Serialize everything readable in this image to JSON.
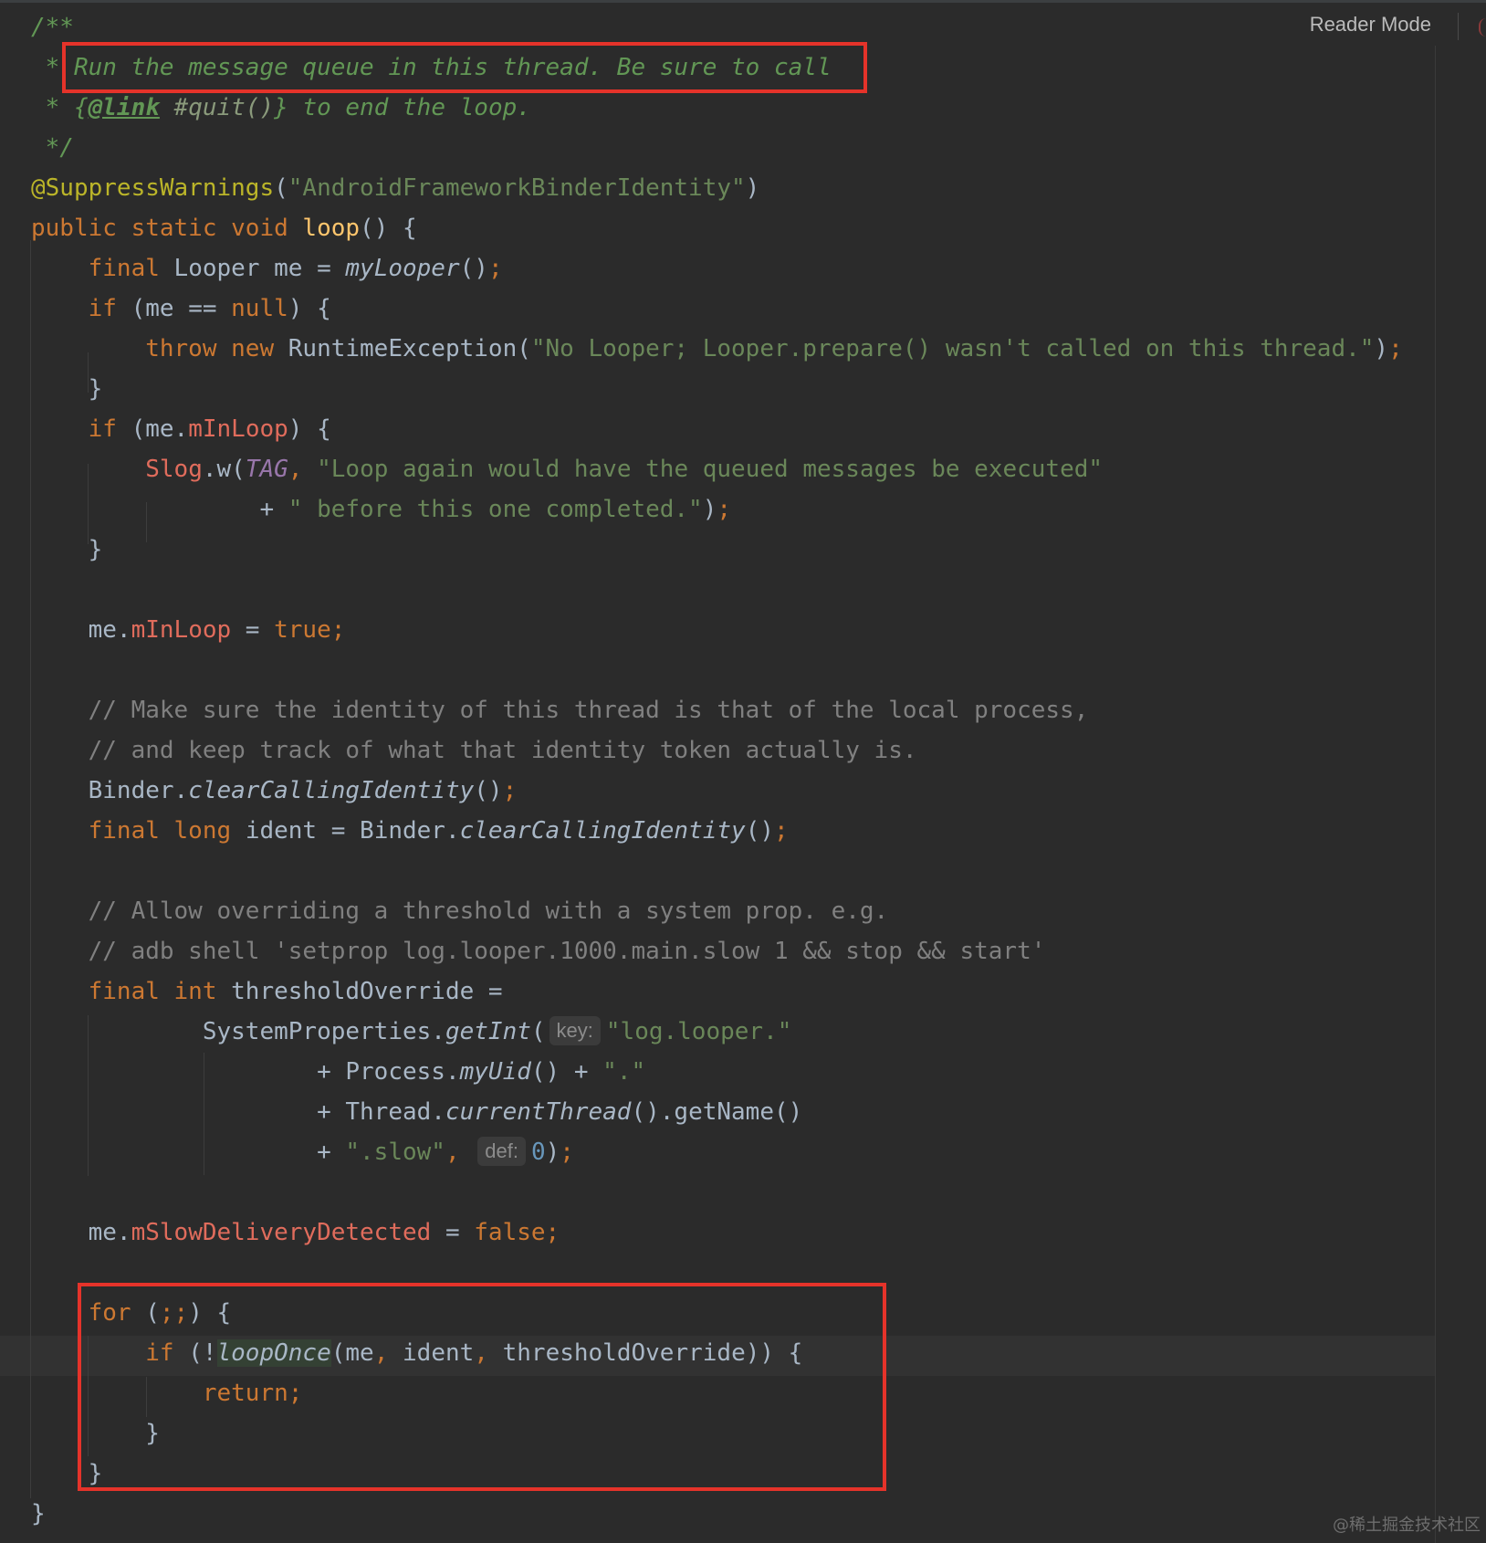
{
  "toolbar": {
    "reader_mode": "Reader Mode"
  },
  "theme": {
    "background": "#2b2b2b",
    "keyword": "#cc7832",
    "string": "#6a8759",
    "doc_comment": "#629755",
    "line_comment": "#808080",
    "field": "#e06c5c",
    "annotation": "#bbb529",
    "method_decl": "#ffc66d",
    "highlight_box": "#e5332a"
  },
  "code_lines": [
    [
      {
        "t": "/**",
        "c": "doc",
        "i": true
      }
    ],
    [
      {
        "t": " * ",
        "c": "doc",
        "i": true
      },
      {
        "t": "Run the message queue in this thread. Be sure to call",
        "c": "doc",
        "i": true
      }
    ],
    [
      {
        "t": " * {",
        "c": "doc",
        "i": true
      },
      {
        "t": "@link",
        "c": "doclink",
        "i": true
      },
      {
        "t": " #quit()",
        "c": "docref",
        "i": true
      },
      {
        "t": "} to end the loop.",
        "c": "doc",
        "i": true
      }
    ],
    [
      {
        "t": " */",
        "c": "doc",
        "i": true
      }
    ],
    [
      {
        "t": "@SuppressWarnings",
        "c": "ann"
      },
      {
        "t": "(",
        "c": "txt"
      },
      {
        "t": "\"AndroidFrameworkBinderIdentity\"",
        "c": "str"
      },
      {
        "t": ")",
        "c": "txt"
      }
    ],
    [
      {
        "t": "public static void ",
        "c": "kw"
      },
      {
        "t": "loop",
        "c": "mdecl"
      },
      {
        "t": "() {",
        "c": "txt"
      }
    ],
    [
      {
        "t": "    final ",
        "c": "kw"
      },
      {
        "t": "Looper me = ",
        "c": "txt"
      },
      {
        "t": "myLooper",
        "c": "txt",
        "i": true
      },
      {
        "t": "()",
        "c": "txt"
      },
      {
        "t": ";",
        "c": "kw"
      }
    ],
    [
      {
        "t": "    if ",
        "c": "kw"
      },
      {
        "t": "(me == ",
        "c": "txt"
      },
      {
        "t": "null",
        "c": "kw"
      },
      {
        "t": ") {",
        "c": "txt"
      }
    ],
    [
      {
        "t": "        throw new ",
        "c": "kw"
      },
      {
        "t": "RuntimeException(",
        "c": "txt"
      },
      {
        "t": "\"No Looper; Looper.prepare() wasn't called on this thread.\"",
        "c": "str"
      },
      {
        "t": ")",
        "c": "txt"
      },
      {
        "t": ";",
        "c": "kw"
      }
    ],
    [
      {
        "t": "    }",
        "c": "txt"
      }
    ],
    [
      {
        "t": "    if ",
        "c": "kw"
      },
      {
        "t": "(me.",
        "c": "txt"
      },
      {
        "t": "mInLoop",
        "c": "fld"
      },
      {
        "t": ") {",
        "c": "txt"
      }
    ],
    [
      {
        "t": "        ",
        "c": "txt"
      },
      {
        "t": "Slog",
        "c": "fld"
      },
      {
        "t": ".w(",
        "c": "txt"
      },
      {
        "t": "TAG",
        "c": "const",
        "i": true
      },
      {
        "t": ", ",
        "c": "kw"
      },
      {
        "t": "\"Loop again would have the queued messages be executed\"",
        "c": "str"
      }
    ],
    [
      {
        "t": "                + ",
        "c": "txt"
      },
      {
        "t": "\" before this one completed.\"",
        "c": "str"
      },
      {
        "t": ")",
        "c": "txt"
      },
      {
        "t": ";",
        "c": "kw"
      }
    ],
    [
      {
        "t": "    }",
        "c": "txt"
      }
    ],
    [],
    [
      {
        "t": "    me.",
        "c": "txt"
      },
      {
        "t": "mInLoop",
        "c": "fld"
      },
      {
        "t": " = ",
        "c": "txt"
      },
      {
        "t": "true;",
        "c": "kw"
      }
    ],
    [],
    [
      {
        "t": "    // Make sure the identity of this thread is that of the local process,",
        "c": "cmt"
      }
    ],
    [
      {
        "t": "    // and keep track of what that identity token actually is.",
        "c": "cmt"
      }
    ],
    [
      {
        "t": "    Binder.",
        "c": "txt"
      },
      {
        "t": "clearCallingIdentity",
        "c": "txt",
        "i": true
      },
      {
        "t": "()",
        "c": "txt"
      },
      {
        "t": ";",
        "c": "kw"
      }
    ],
    [
      {
        "t": "    final long ",
        "c": "kw"
      },
      {
        "t": "ident = Binder.",
        "c": "txt"
      },
      {
        "t": "clearCallingIdentity",
        "c": "txt",
        "i": true
      },
      {
        "t": "()",
        "c": "txt"
      },
      {
        "t": ";",
        "c": "kw"
      }
    ],
    [],
    [
      {
        "t": "    // Allow overriding a threshold with a system prop. e.g.",
        "c": "cmt"
      }
    ],
    [
      {
        "t": "    // adb shell 'setprop log.looper.1000.main.slow 1 && stop && start'",
        "c": "cmt"
      }
    ],
    [
      {
        "t": "    final int ",
        "c": "kw"
      },
      {
        "t": "thresholdOverride =",
        "c": "txt"
      }
    ],
    [
      {
        "t": "            SystemProperties.",
        "c": "txt"
      },
      {
        "t": "getInt",
        "c": "txt",
        "i": true
      },
      {
        "t": "(",
        "c": "txt"
      },
      {
        "t": "key:",
        "c": "hint"
      },
      {
        "t": "\"log.looper.\"",
        "c": "str"
      }
    ],
    [
      {
        "t": "                    + Process.",
        "c": "txt"
      },
      {
        "t": "myUid",
        "c": "txt",
        "i": true
      },
      {
        "t": "() + ",
        "c": "txt"
      },
      {
        "t": "\".\"",
        "c": "str"
      }
    ],
    [
      {
        "t": "                    + Thread.",
        "c": "txt"
      },
      {
        "t": "currentThread",
        "c": "txt",
        "i": true
      },
      {
        "t": "().getName()",
        "c": "txt"
      }
    ],
    [
      {
        "t": "                    + ",
        "c": "txt"
      },
      {
        "t": "\".slow\"",
        "c": "str"
      },
      {
        "t": ", ",
        "c": "kw"
      },
      {
        "t": "def:",
        "c": "hint"
      },
      {
        "t": "0",
        "c": "num"
      },
      {
        "t": ")",
        "c": "txt"
      },
      {
        "t": ";",
        "c": "kw"
      }
    ],
    [],
    [
      {
        "t": "    me.",
        "c": "txt"
      },
      {
        "t": "mSlowDeliveryDetected",
        "c": "fld"
      },
      {
        "t": " = ",
        "c": "txt"
      },
      {
        "t": "false;",
        "c": "kw"
      }
    ],
    [],
    [
      {
        "t": "    for ",
        "c": "kw"
      },
      {
        "t": "(",
        "c": "txt"
      },
      {
        "t": ";;",
        "c": "kw"
      },
      {
        "t": ") {",
        "c": "txt"
      }
    ],
    [
      {
        "t": "        if ",
        "c": "kw"
      },
      {
        "t": "(!",
        "c": "txt"
      },
      {
        "t": "loopOnce",
        "c": "txt",
        "i": true,
        "bg": true
      },
      {
        "t": "(me",
        "c": "txt"
      },
      {
        "t": ", ",
        "c": "kw"
      },
      {
        "t": "ident",
        "c": "txt"
      },
      {
        "t": ", ",
        "c": "kw"
      },
      {
        "t": "thresholdOverride)) {",
        "c": "txt"
      }
    ],
    [
      {
        "t": "            return;",
        "c": "kw"
      }
    ],
    [
      {
        "t": "        }",
        "c": "txt"
      }
    ],
    [
      {
        "t": "    }",
        "c": "txt"
      }
    ],
    [
      {
        "t": "}",
        "c": "txt"
      }
    ]
  ],
  "watermark": "@稀土掘金技术社区"
}
